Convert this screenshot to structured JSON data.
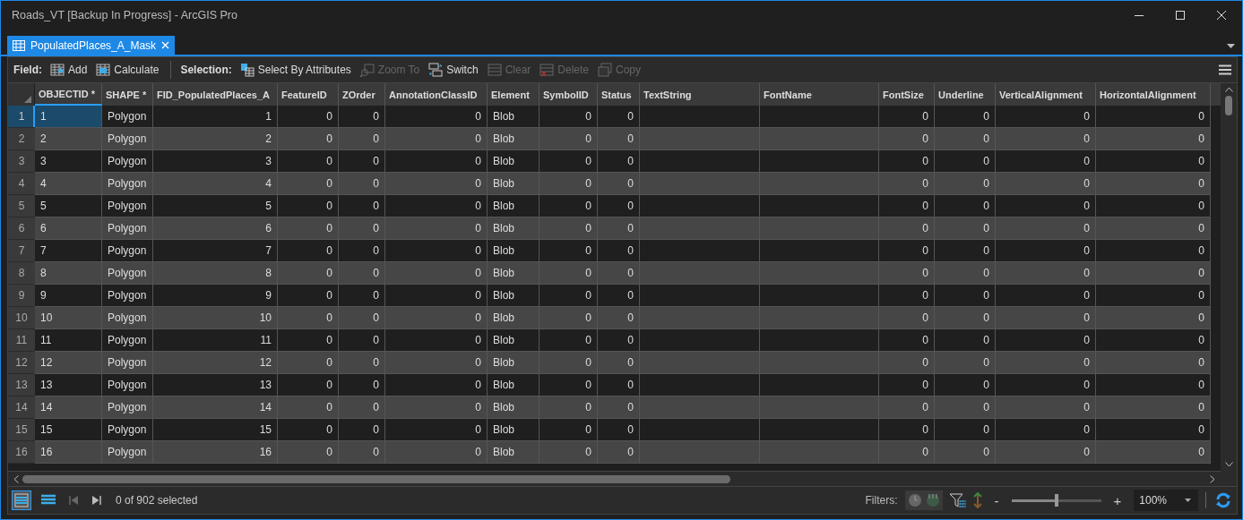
{
  "window": {
    "title": "Roads_VT [Backup In Progress] - ArcGIS Pro"
  },
  "tabs": [
    {
      "label": "PopulatedPlaces_A_Mask",
      "selected": true
    }
  ],
  "toolbar": {
    "groups": [
      {
        "label": "Field:",
        "buttons": [
          {
            "label": "Add",
            "disabled": false
          },
          {
            "label": "Calculate",
            "disabled": false
          }
        ]
      },
      {
        "label": "Selection:",
        "buttons": [
          {
            "label": "Select By Attributes",
            "disabled": false
          },
          {
            "label": "Zoom To",
            "disabled": true
          },
          {
            "label": "Switch",
            "disabled": false
          },
          {
            "label": "Clear",
            "disabled": true
          },
          {
            "label": "Delete",
            "disabled": true
          },
          {
            "label": "Copy",
            "disabled": true
          }
        ]
      }
    ]
  },
  "table": {
    "columns": [
      {
        "label": "OBJECTID *",
        "kind": "text"
      },
      {
        "label": "SHAPE *",
        "kind": "text"
      },
      {
        "label": "FID_PopulatedPlaces_A",
        "kind": "number"
      },
      {
        "label": "FeatureID",
        "kind": "number"
      },
      {
        "label": "ZOrder",
        "kind": "number"
      },
      {
        "label": "AnnotationClassID",
        "kind": "number"
      },
      {
        "label": "Element",
        "kind": "text"
      },
      {
        "label": "SymbolID",
        "kind": "number"
      },
      {
        "label": "Status",
        "kind": "number"
      },
      {
        "label": "TextString",
        "kind": "text"
      },
      {
        "label": "FontName",
        "kind": "text"
      },
      {
        "label": "FontSize",
        "kind": "number"
      },
      {
        "label": "Underline",
        "kind": "number"
      },
      {
        "label": "VerticalAlignment",
        "kind": "number"
      },
      {
        "label": "HorizontalAlignment",
        "kind": "number"
      }
    ],
    "rows": [
      {
        "number": "1",
        "selected": true,
        "cells": [
          "1",
          "Polygon",
          "1",
          "0",
          "0",
          "0",
          "Blob",
          "0",
          "0",
          "",
          "",
          "0",
          "0",
          "0",
          "0"
        ]
      },
      {
        "number": "2",
        "selected": false,
        "cells": [
          "2",
          "Polygon",
          "2",
          "0",
          "0",
          "0",
          "Blob",
          "0",
          "0",
          "",
          "",
          "0",
          "0",
          "0",
          "0"
        ]
      },
      {
        "number": "3",
        "selected": false,
        "cells": [
          "3",
          "Polygon",
          "3",
          "0",
          "0",
          "0",
          "Blob",
          "0",
          "0",
          "",
          "",
          "0",
          "0",
          "0",
          "0"
        ]
      },
      {
        "number": "4",
        "selected": false,
        "cells": [
          "4",
          "Polygon",
          "4",
          "0",
          "0",
          "0",
          "Blob",
          "0",
          "0",
          "",
          "",
          "0",
          "0",
          "0",
          "0"
        ]
      },
      {
        "number": "5",
        "selected": false,
        "cells": [
          "5",
          "Polygon",
          "5",
          "0",
          "0",
          "0",
          "Blob",
          "0",
          "0",
          "",
          "",
          "0",
          "0",
          "0",
          "0"
        ]
      },
      {
        "number": "6",
        "selected": false,
        "cells": [
          "6",
          "Polygon",
          "6",
          "0",
          "0",
          "0",
          "Blob",
          "0",
          "0",
          "",
          "",
          "0",
          "0",
          "0",
          "0"
        ]
      },
      {
        "number": "7",
        "selected": false,
        "cells": [
          "7",
          "Polygon",
          "7",
          "0",
          "0",
          "0",
          "Blob",
          "0",
          "0",
          "",
          "",
          "0",
          "0",
          "0",
          "0"
        ]
      },
      {
        "number": "8",
        "selected": false,
        "cells": [
          "8",
          "Polygon",
          "8",
          "0",
          "0",
          "0",
          "Blob",
          "0",
          "0",
          "",
          "",
          "0",
          "0",
          "0",
          "0"
        ]
      },
      {
        "number": "9",
        "selected": false,
        "cells": [
          "9",
          "Polygon",
          "9",
          "0",
          "0",
          "0",
          "Blob",
          "0",
          "0",
          "",
          "",
          "0",
          "0",
          "0",
          "0"
        ]
      },
      {
        "number": "10",
        "selected": false,
        "cells": [
          "10",
          "Polygon",
          "10",
          "0",
          "0",
          "0",
          "Blob",
          "0",
          "0",
          "",
          "",
          "0",
          "0",
          "0",
          "0"
        ]
      },
      {
        "number": "11",
        "selected": false,
        "cells": [
          "11",
          "Polygon",
          "11",
          "0",
          "0",
          "0",
          "Blob",
          "0",
          "0",
          "",
          "",
          "0",
          "0",
          "0",
          "0"
        ]
      },
      {
        "number": "12",
        "selected": false,
        "cells": [
          "12",
          "Polygon",
          "12",
          "0",
          "0",
          "0",
          "Blob",
          "0",
          "0",
          "",
          "",
          "0",
          "0",
          "0",
          "0"
        ]
      },
      {
        "number": "13",
        "selected": false,
        "cells": [
          "13",
          "Polygon",
          "13",
          "0",
          "0",
          "0",
          "Blob",
          "0",
          "0",
          "",
          "",
          "0",
          "0",
          "0",
          "0"
        ]
      },
      {
        "number": "14",
        "selected": false,
        "cells": [
          "14",
          "Polygon",
          "14",
          "0",
          "0",
          "0",
          "Blob",
          "0",
          "0",
          "",
          "",
          "0",
          "0",
          "0",
          "0"
        ]
      },
      {
        "number": "15",
        "selected": false,
        "cells": [
          "15",
          "Polygon",
          "15",
          "0",
          "0",
          "0",
          "Blob",
          "0",
          "0",
          "",
          "",
          "0",
          "0",
          "0",
          "0"
        ]
      },
      {
        "number": "16",
        "selected": false,
        "cells": [
          "16",
          "Polygon",
          "16",
          "0",
          "0",
          "0",
          "Blob",
          "0",
          "0",
          "",
          "",
          "0",
          "0",
          "0",
          "0"
        ]
      }
    ]
  },
  "status_bar": {
    "views": [
      {
        "selected": true
      },
      {
        "selected": false
      }
    ],
    "selection_text": "0 of 902 selected",
    "filters_label": "Filters:",
    "zoom_minus": "-",
    "zoom_plus": "+",
    "zoom": {
      "level": 0.5
    },
    "zoom_value": "100%"
  }
}
